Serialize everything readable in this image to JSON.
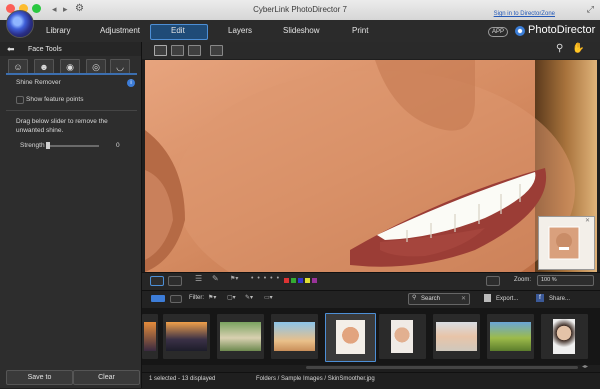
{
  "window": {
    "title": "CyberLink PhotoDirector 7",
    "sign_in": "Sign in to DirectorZone"
  },
  "nav": {
    "tabs": [
      "Library",
      "Adjustment",
      "Edit",
      "Layers",
      "Slideshow",
      "Print"
    ],
    "active": "Edit",
    "app_badge": "APP",
    "brand": "PhotoDirector"
  },
  "panel": {
    "title": "Face Tools",
    "subtool": "Shine Remover",
    "show_feature_points": "Show feature points",
    "instruction": "Drag below slider to remove the unwanted shine.",
    "strength_label": "Strength",
    "strength_value": "0",
    "save_to": "Save to",
    "clear": "Clear"
  },
  "viewbar": {
    "zoom_label": "Zoom:",
    "zoom_value": "100 %"
  },
  "filterbar": {
    "filter_label": "Filter:",
    "search_placeholder": "Search",
    "export": "Export...",
    "share": "Share..."
  },
  "status": {
    "selection": "1 selected - 13 displayed",
    "path": "Folders / Sample Images / SkinSmoother.jpg"
  },
  "colors": {
    "accent": "#3d7dd8",
    "active_tab": "#1f4b77",
    "panel_bg": "#2d2d2d"
  }
}
